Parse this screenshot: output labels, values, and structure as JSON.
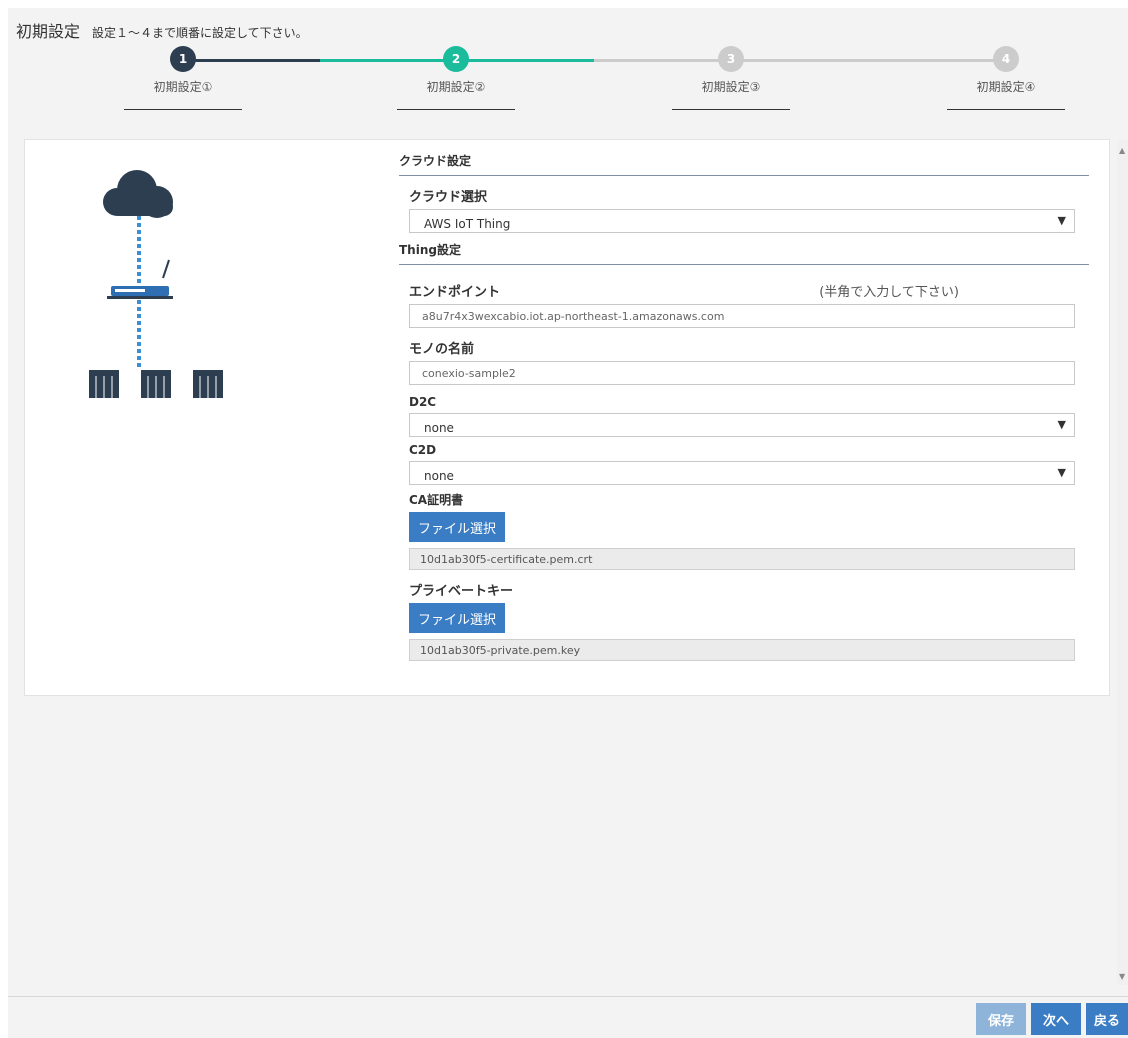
{
  "header": {
    "title": "初期設定",
    "subtitle": "設定１～４まで順番に設定して下さい。"
  },
  "stepper": {
    "steps": [
      {
        "number": "1",
        "label": "初期設定①",
        "state": "done"
      },
      {
        "number": "2",
        "label": "初期設定②",
        "state": "active"
      },
      {
        "number": "3",
        "label": "初期設定③",
        "state": "pending"
      },
      {
        "number": "4",
        "label": "初期設定④",
        "state": "pending"
      }
    ],
    "colors": {
      "done": "#2c3e50",
      "active": "#1abc9c",
      "pending": "#cccccc"
    }
  },
  "diagram": {
    "icons": [
      "cloud-icon",
      "router-icon",
      "plc-device-icon"
    ]
  },
  "form": {
    "cloud_section": "クラウド設定",
    "cloud_select_label": "クラウド選択",
    "cloud_select_value": "AWS IoT Thing",
    "thing_section": "Thing設定",
    "endpoint_label": "エンドポイント",
    "endpoint_hint": "(半角で入力して下さい)",
    "endpoint_value": "a8u7r4x3wexcabio.iot.ap-northeast-1.amazonaws.com",
    "thing_name_label": "モノの名前",
    "thing_name_value": "conexio-sample2",
    "d2c_label": "D2C",
    "d2c_value": "none",
    "c2d_label": "C2D",
    "c2d_value": "none",
    "ca_label": "CA証明書",
    "ca_button": "ファイル選択",
    "ca_file": "10d1ab30f5-certificate.pem.crt",
    "key_label": "プライベートキー",
    "key_button": "ファイル選択",
    "key_file": "10d1ab30f5-private.pem.key"
  },
  "footer": {
    "save_label": "保存",
    "next_label": "次へ",
    "back_label": "戻る",
    "colors": {
      "save": "#8fb4d9",
      "next": "#3b7dc4",
      "back": "#3b7dc4"
    }
  }
}
